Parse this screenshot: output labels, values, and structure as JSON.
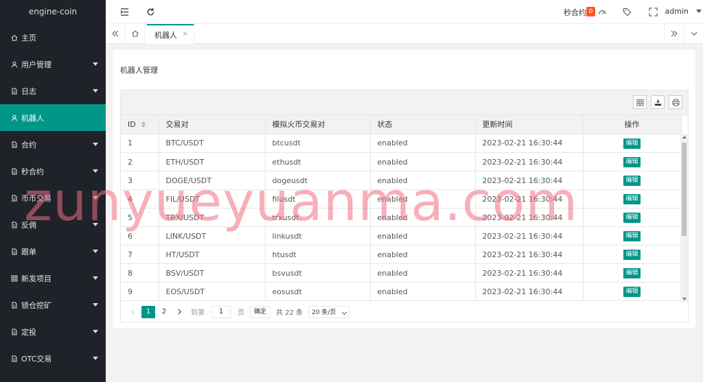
{
  "app": {
    "title": "engine-coin"
  },
  "sidebar": {
    "items": [
      {
        "label": "主页",
        "icon": "home-icon",
        "caret": false,
        "active": false
      },
      {
        "label": "用户管理",
        "icon": "user-icon",
        "caret": true,
        "active": false
      },
      {
        "label": "日志",
        "icon": "file-icon",
        "caret": true,
        "active": false
      },
      {
        "label": "机器人",
        "icon": "user-icon",
        "caret": false,
        "active": true
      },
      {
        "label": "合约",
        "icon": "file-icon",
        "caret": true,
        "active": false
      },
      {
        "label": "秒合约",
        "icon": "file-icon",
        "caret": true,
        "active": false
      },
      {
        "label": "币币交易",
        "icon": "file-icon",
        "caret": true,
        "active": false
      },
      {
        "label": "反佣",
        "icon": "file-icon",
        "caret": true,
        "active": false
      },
      {
        "label": "跟单",
        "icon": "file-icon",
        "caret": true,
        "active": false
      },
      {
        "label": "新发项目",
        "icon": "grid-icon",
        "caret": true,
        "active": false
      },
      {
        "label": "锁仓挖矿",
        "icon": "file-icon",
        "caret": true,
        "active": false
      },
      {
        "label": "定投",
        "icon": "file-icon",
        "caret": true,
        "active": false
      },
      {
        "label": "OTC交易",
        "icon": "file-icon",
        "caret": true,
        "active": false
      }
    ]
  },
  "header": {
    "sec_contract_label": "秒合约",
    "sec_contract_count": "0",
    "user": "admin"
  },
  "tabs": {
    "active_label": "机器人",
    "close": "×"
  },
  "page": {
    "title": "机器人管理"
  },
  "table": {
    "columns": [
      "ID",
      "交易对",
      "模拟火币交易对",
      "状态",
      "更新时间",
      "操作"
    ],
    "edit_label": "编辑",
    "rows": [
      {
        "id": "1",
        "pair": "BTC/USDT",
        "sim": "btcusdt",
        "status": "enabled",
        "updated": "2023-02-21 16:30:44"
      },
      {
        "id": "2",
        "pair": "ETH/USDT",
        "sim": "ethusdt",
        "status": "enabled",
        "updated": "2023-02-21 16:30:44"
      },
      {
        "id": "3",
        "pair": "DOGE/USDT",
        "sim": "dogeusdt",
        "status": "enabled",
        "updated": "2023-02-21 16:30:44"
      },
      {
        "id": "4",
        "pair": "FIL/USDT",
        "sim": "filusdt",
        "status": "enabled",
        "updated": "2023-02-21 16:30:44"
      },
      {
        "id": "5",
        "pair": "TRX/USDT",
        "sim": "trxusdt",
        "status": "enabled",
        "updated": "2023-02-21 16:30:44"
      },
      {
        "id": "6",
        "pair": "LINK/USDT",
        "sim": "linkusdt",
        "status": "enabled",
        "updated": "2023-02-21 16:30:44"
      },
      {
        "id": "7",
        "pair": "HT/USDT",
        "sim": "htusdt",
        "status": "enabled",
        "updated": "2023-02-21 16:30:44"
      },
      {
        "id": "8",
        "pair": "BSV/USDT",
        "sim": "bsvusdt",
        "status": "enabled",
        "updated": "2023-02-21 16:30:44"
      },
      {
        "id": "9",
        "pair": "EOS/USDT",
        "sim": "eosusdt",
        "status": "enabled",
        "updated": "2023-02-21 16:30:44"
      }
    ]
  },
  "pager": {
    "pages": [
      "1",
      "2"
    ],
    "current": "1",
    "goto_label": "到第",
    "goto_value": "1",
    "page_unit": "页",
    "confirm": "确定",
    "total": "共 22 条",
    "per_page": "20 条/页"
  },
  "watermark": "zunyueyuanma.com",
  "colors": {
    "accent": "#009688",
    "sidebar_bg": "#20222a",
    "badge": "#ff5722"
  }
}
